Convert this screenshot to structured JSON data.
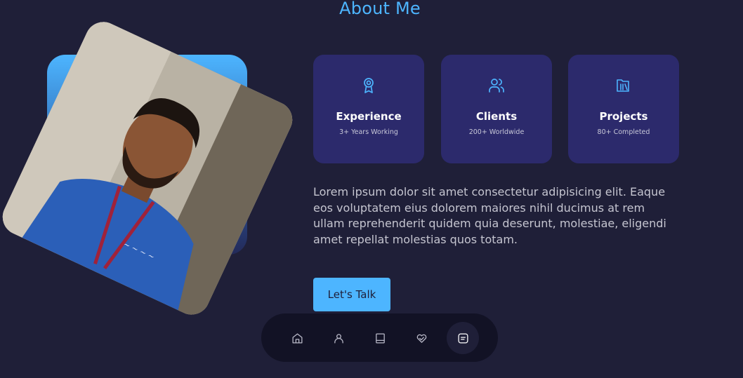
{
  "header": {
    "title": "About Me"
  },
  "photo": {
    "alt": "Portrait photo"
  },
  "cards": [
    {
      "icon": "award-icon",
      "title": "Experience",
      "subtitle": "3+ Years Working"
    },
    {
      "icon": "users-icon",
      "title": "Clients",
      "subtitle": "200+ Worldwide"
    },
    {
      "icon": "folder-icon",
      "title": "Projects",
      "subtitle": "80+ Completed"
    }
  ],
  "about": {
    "text": "Lorem ipsum dolor sit amet consectetur adipisicing elit. Eaque eos voluptatem eius dolorem maiores nihil ducimus at rem ullam reprehenderit quidem quia deserunt, molestiae, eligendi amet repellat molestias quos totam."
  },
  "cta": {
    "label": "Let's Talk"
  },
  "nav": {
    "items": [
      {
        "icon": "home-icon"
      },
      {
        "icon": "user-icon"
      },
      {
        "icon": "book-icon"
      },
      {
        "icon": "services-icon"
      },
      {
        "icon": "message-icon",
        "active": true
      }
    ]
  },
  "colors": {
    "background": "#1f1f38",
    "accent": "#4db5ff",
    "card": "#2c2a6c",
    "nav": "#121225"
  }
}
